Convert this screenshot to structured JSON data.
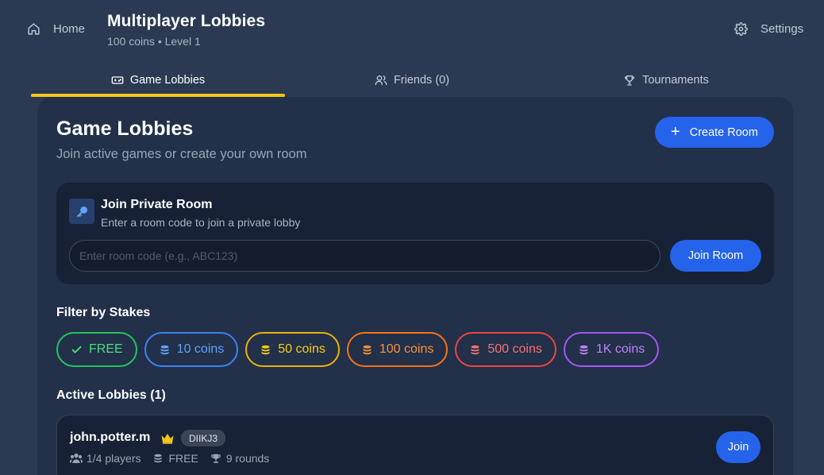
{
  "header": {
    "home_label": "Home",
    "title": "Multiplayer Lobbies",
    "subtitle": "100 coins • Level 1",
    "settings_label": "Settings"
  },
  "tabs": [
    {
      "label": "Game Lobbies",
      "icon": "gamepad-icon",
      "active": true
    },
    {
      "label": "Friends (0)",
      "icon": "users-icon",
      "active": false
    },
    {
      "label": "Tournaments",
      "icon": "trophy-icon",
      "active": false
    }
  ],
  "main": {
    "title": "Game Lobbies",
    "subtitle": "Join active games or create your own room",
    "create_button": "Create Room"
  },
  "private_room": {
    "title": "Join Private Room",
    "subtitle": "Enter a room code to join a private lobby",
    "input_placeholder": "Enter room code (e.g., ABC123)",
    "input_value": "",
    "join_button": "Join Room"
  },
  "filter": {
    "label": "Filter by Stakes",
    "chips": [
      {
        "label": "FREE",
        "icon": "check-icon",
        "color": "#22c55e",
        "selected": true
      },
      {
        "label": "10 coins",
        "icon": "coins-icon",
        "color": "#3b82f6"
      },
      {
        "label": "50 coins",
        "icon": "coins-icon",
        "color": "#eab308"
      },
      {
        "label": "100 coins",
        "icon": "coins-icon",
        "color": "#f97316"
      },
      {
        "label": "500 coins",
        "icon": "coins-icon",
        "color": "#ef4444"
      },
      {
        "label": "1K coins",
        "icon": "coins-icon",
        "color": "#a855f7"
      }
    ]
  },
  "lobbies": {
    "label": "Active Lobbies (1)",
    "items": [
      {
        "host": "john.potter.m",
        "code": "DIIKJ3",
        "players": "1/4 players",
        "stake": "FREE",
        "rounds": "9 rounds",
        "join_label": "Join"
      }
    ]
  },
  "colors": {
    "accent": "#2563eb",
    "tab_underline": "#f5c518",
    "crown": "#f5c518"
  }
}
